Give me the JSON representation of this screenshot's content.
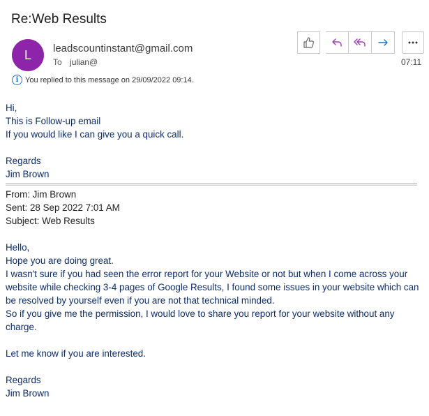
{
  "subject": "Re:Web Results",
  "sender": {
    "initial": "L",
    "email": "leadscountinstant@gmail.com",
    "avatar_color": "#8e24aa"
  },
  "to": {
    "label": "To",
    "recipient": "julian@"
  },
  "time": "07:11",
  "notice": "You replied to this message on 29/09/2022 09:14.",
  "toolbar": {
    "like_icon": "thumbs-up-icon",
    "reply_icon": "reply-icon",
    "reply_all_icon": "reply-all-icon",
    "forward_icon": "forward-icon",
    "more_icon": "more-icon"
  },
  "reply": {
    "lines": [
      "Hi,",
      "This is Follow-up email",
      "If you would like I can give you a quick call."
    ],
    "sign_lines": [
      "Regards",
      "Jim Brown"
    ]
  },
  "quoted_header": {
    "from": "From: Jim Brown",
    "sent": "Sent: 28 Sep 2022 7:01 AM",
    "subject": "Subject: Web Results"
  },
  "original": {
    "greeting": "Hello,",
    "line1": "Hope you are doing great.",
    "line2": "I wasn't sure if you had seen the error report for your Website or not but when I come across your website while checking 3-4 pages of Google Results, I found some issues in your website which can be resolved by yourself even if you are not that technical minded.",
    "line3": "So if you give me the permission, I would love to share you report for your website without any charge.",
    "line4": "Let me know if you are interested.",
    "sign1": "Regards",
    "sign2": "Jim Brown"
  }
}
